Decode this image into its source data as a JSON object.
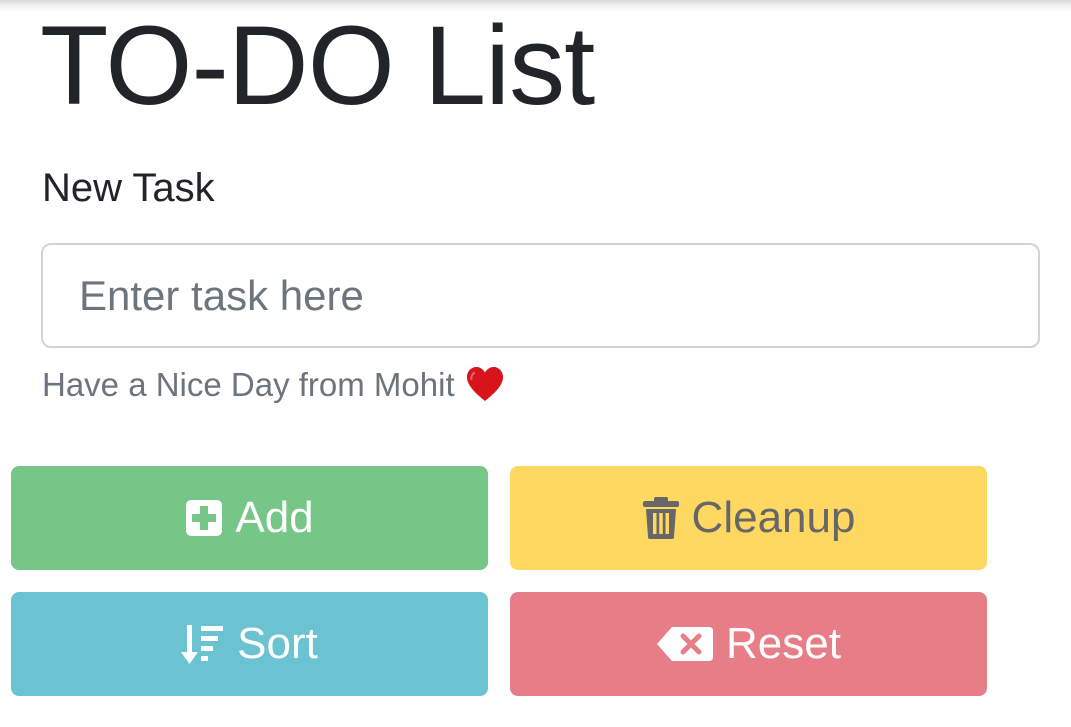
{
  "app": {
    "title": "TO-DO List"
  },
  "form": {
    "label": "New Task",
    "input_value": "",
    "input_placeholder": "Enter task here",
    "help_text": "Have a Nice Day from Mohit",
    "help_icon": "heart-icon"
  },
  "buttons": {
    "add": {
      "label": "Add",
      "icon": "plus-square-icon",
      "color": "#75c687"
    },
    "cleanup": {
      "label": "Cleanup",
      "icon": "trash-icon",
      "color": "#ffd862"
    },
    "sort": {
      "label": "Sort",
      "icon": "sort-down-icon",
      "color": "#6bc3d2"
    },
    "reset": {
      "label": "Reset",
      "icon": "backspace-icon",
      "color": "#e77d86"
    }
  },
  "colors": {
    "heading": "#212529",
    "muted": "#6c757d",
    "heart": "#d7141a"
  }
}
